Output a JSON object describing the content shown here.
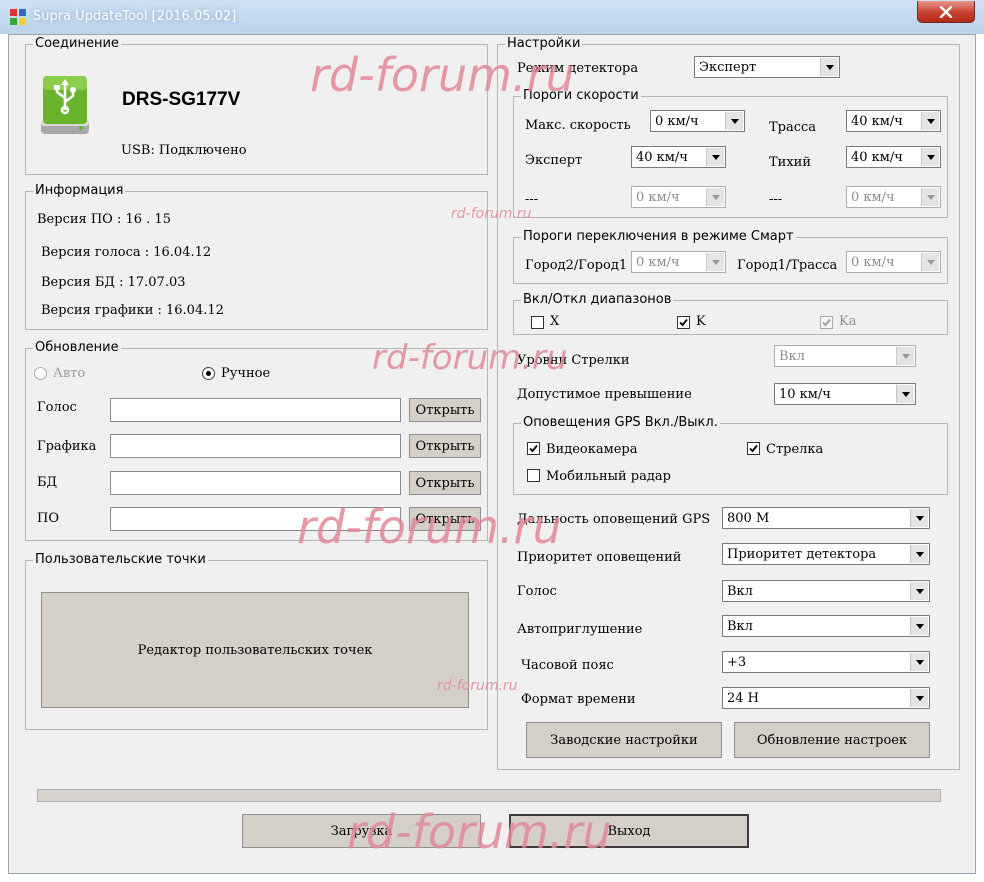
{
  "window": {
    "title": "Supra UpdateTool [2016.05.02]"
  },
  "connection": {
    "group_title": "Соединение",
    "device_name": "DRS-SG177V",
    "usb_status": "USB: Подключено",
    "icon": "usb-drive-icon"
  },
  "info": {
    "group_title": "Информация",
    "fw_version": "Версия ПО : 16 . 15",
    "voice_version": "Версия голоса : 16.04.12",
    "db_version": "Версия БД : 17.07.03",
    "graphics_version": "Версия графики : 16.04.12"
  },
  "update": {
    "group_title": "Обновление",
    "auto_label": "Авто",
    "manual_label": "Ручное",
    "selected_mode": "Ручное",
    "rows": [
      {
        "label": "Голос",
        "value": "",
        "button": "Открыть"
      },
      {
        "label": "Графика",
        "value": "",
        "button": "Открыть"
      },
      {
        "label": "БД",
        "value": "",
        "button": "Открыть"
      },
      {
        "label": "ПО",
        "value": "",
        "button": "Открыть"
      }
    ]
  },
  "user_points": {
    "group_title": "Пользовательские точки",
    "editor_button": "Редактор пользовательских точек"
  },
  "settings": {
    "group_title": "Настройки",
    "detector_mode_label": "Режим детектора",
    "detector_mode_value": "Эксперт",
    "speed_thresholds": {
      "group_title": "Пороги скорости",
      "max_speed_label": "Макс. скорость",
      "max_speed_value": "0 км/ч",
      "highway_label": "Трасса",
      "highway_value": "40 км/ч",
      "expert_label": "Эксперт",
      "expert_value": "40 км/ч",
      "quiet_label": "Тихий",
      "quiet_value": "40 км/ч",
      "blank1_label": "---",
      "blank1_value": "0 км/ч",
      "blank2_label": "---",
      "blank2_value": "0 км/ч"
    },
    "smart_thresholds": {
      "group_title": "Пороги переключения в режиме Смарт",
      "city2_label": "Город2/Город1",
      "city2_value": "0 км/ч",
      "city1_label": "Город1/Трасса",
      "city1_value": "0 км/ч"
    },
    "bands": {
      "group_title": "Вкл/Откл диапазонов",
      "x_label": "X",
      "x_checked": false,
      "k_label": "K",
      "k_checked": true,
      "ka_label": "Ka",
      "ka_checked": true
    },
    "arrow_levels_label": "Уровни Стрелки",
    "arrow_levels_value": "Вкл",
    "allowed_excess_label": "Допустимое превышение",
    "allowed_excess_value": "10 км/ч",
    "gps_alerts": {
      "group_title": "Оповещения GPS Вкл./Выкл.",
      "camera_label": "Видеокамера",
      "camera_checked": true,
      "strelka_label": "Стрелка",
      "strelka_checked": true,
      "mobile_label": "Мобильный радар",
      "mobile_checked": false
    },
    "gps_distance_label": "Дальность оповещений GPS",
    "gps_distance_value": "800 М",
    "alert_priority_label": "Приоритет оповещений",
    "alert_priority_value": "Приоритет детектора",
    "voice_label": "Голос",
    "voice_value": "Вкл",
    "auto_mute_label": "Автоприглушение",
    "auto_mute_value": "Вкл",
    "timezone_label": "Часовой пояс",
    "timezone_value": "+3",
    "time_format_label": "Формат времени",
    "time_format_value": "24 H",
    "factory_button": "Заводские настройки",
    "update_settings_button": "Обновление настроек"
  },
  "progress": {
    "value": 0
  },
  "footer": {
    "load_button": "Загрузка",
    "exit_button": "Выход"
  },
  "watermark": "rd-forum.ru",
  "colors": {
    "accent": "#2b6cb0",
    "device_icon": "#6ab42d",
    "close_button": "#c9412f"
  }
}
